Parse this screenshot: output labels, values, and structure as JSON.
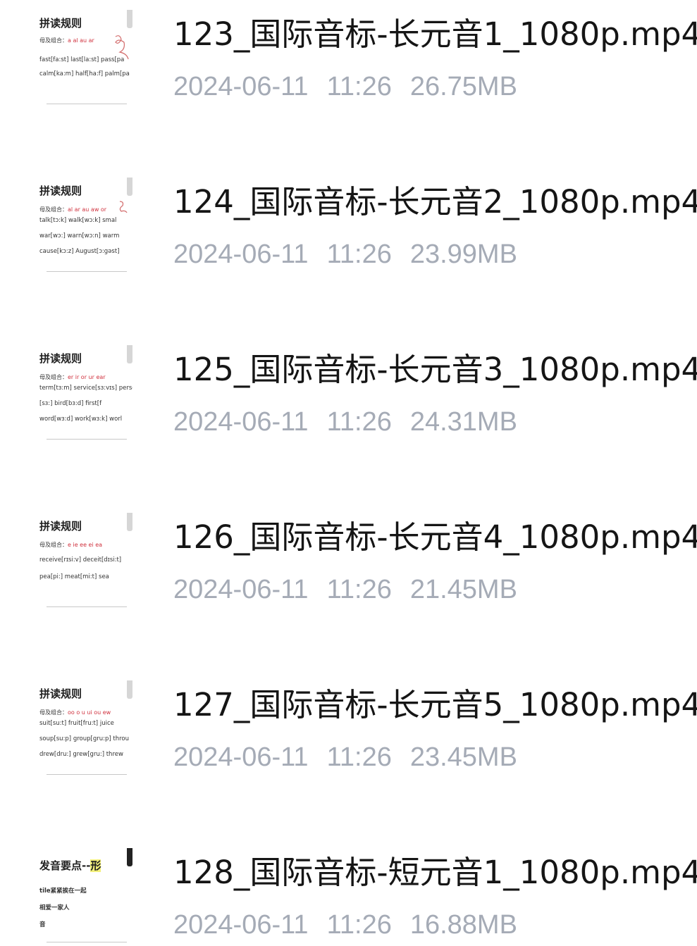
{
  "files": [
    {
      "name": "123_国际音标-长元音1_1080p.mp4",
      "date": "2024-06-11",
      "time": "11:26",
      "size": "26.75MB",
      "thumb": {
        "heading": "拼读规则",
        "subtitle_label": "母及组合：",
        "subtitle_value": "a al au ar",
        "lines": [
          "fast[fa:st]   last[la:st]   pass[pa",
          "calm[ka:m]  half[ha:f]   palm[pa"
        ]
      }
    },
    {
      "name": "124_国际音标-长元音2_1080p.mp4",
      "date": "2024-06-11",
      "time": "11:26",
      "size": "23.99MB",
      "thumb": {
        "heading": "拼读规则",
        "subtitle_label": "母及组合：",
        "subtitle_value": "al ar au aw or",
        "lines": [
          "talk[tɔ:k]    walk[wɔ:k]    smal",
          "war[wɔ:]     warn[wɔ:n]    warm",
          "cause[kɔ:z]   August[ɔ:gəst]"
        ]
      }
    },
    {
      "name": "125_国际音标-长元音3_1080p.mp4",
      "date": "2024-06-11",
      "time": "11:26",
      "size": "24.31MB",
      "thumb": {
        "heading": "拼读规则",
        "subtitle_label": "母及组合：",
        "subtitle_value": "er ir or ur ear",
        "lines": [
          "term[tɜ:m]  service[sɜ:vɪs]  perso",
          "[sɜ:]       bird[bɜ:d]       first[f",
          "word[wɜ:d]  work[wɜ:k]       worl"
        ]
      }
    },
    {
      "name": "126_国际音标-长元音4_1080p.mp4",
      "date": "2024-06-11",
      "time": "11:26",
      "size": "21.45MB",
      "thumb": {
        "heading": "拼读规则",
        "subtitle_label": "母及组合：",
        "subtitle_value": "e ie ee ei ea",
        "lines": [
          "receive[rɪsi:v]   deceit[dɪsi:t]",
          "pea[pi:]     meat[mi:t]     sea"
        ]
      }
    },
    {
      "name": "127_国际音标-长元音5_1080p.mp4",
      "date": "2024-06-11",
      "time": "11:26",
      "size": "23.45MB",
      "thumb": {
        "heading": "拼读规则",
        "subtitle_label": "母及组合：",
        "subtitle_value": "oo o u ui ou ew",
        "lines": [
          "suit[su:t]     fruit[fru:t]     juice",
          "soup[su:p]  group[gru:p]  throu",
          "drew[dru:]   grew[gru:]      threw"
        ]
      }
    },
    {
      "name": "128_国际音标-短元音1_1080p.mp4",
      "date": "2024-06-11",
      "time": "11:26",
      "size": "16.88MB",
      "thumb": {
        "heading": "发音要点--",
        "heading_highlight": "形",
        "subtitle_label": "",
        "subtitle_value": "",
        "lines": [
          "tile紧紧挨在一起",
          "相爱一家人",
          "音"
        ]
      }
    }
  ]
}
